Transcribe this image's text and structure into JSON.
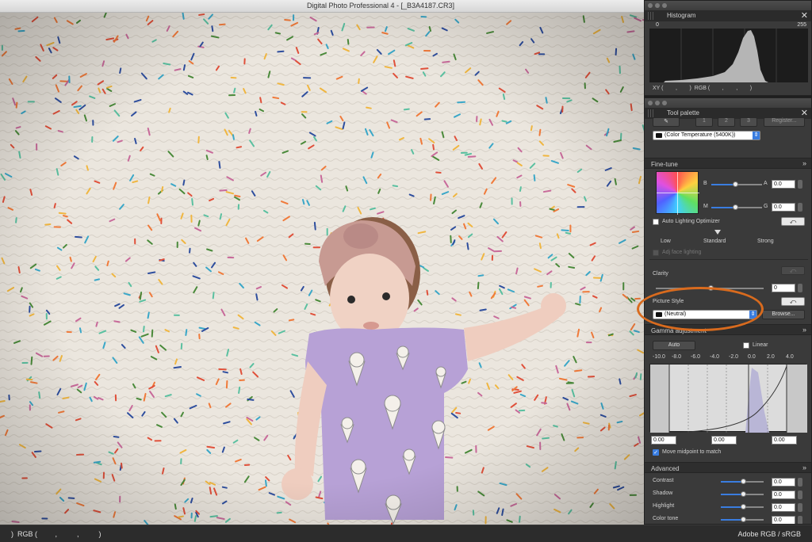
{
  "window": {
    "title": "Digital Photo Professional 4 - [_B3A4187.CR3]"
  },
  "histogram": {
    "title": "Histogram",
    "scale_min": "0",
    "scale_max": "255",
    "readout": "XY (        ,        )  RGB (        ,        ,        )"
  },
  "tool_palette": {
    "title": "Tool palette",
    "tabs": [
      "1",
      "2",
      "3"
    ],
    "register_label": "Register...",
    "wb_select": "(Color Temperature (5400K))",
    "finetune": {
      "title": "Fine-tune",
      "b_label": "B",
      "a_label": "A",
      "m_label": "M",
      "g_label": "G",
      "a_value": "0.0",
      "g_value": "0.0",
      "b_slider": 0.5,
      "m_slider": 0.5
    },
    "alo": {
      "label": "Auto Lighting Optimizer",
      "low": "Low",
      "standard": "Standard",
      "strong": "Strong",
      "face_label": "Adj face lighting"
    },
    "clarity": {
      "label": "Clarity",
      "value": "0"
    },
    "picture_style": {
      "label": "Picture Style",
      "value": "(Neutral)",
      "browse_label": "Browse..."
    },
    "gamma": {
      "title": "Gamma adjustment",
      "auto_label": "Auto",
      "linear_label": "Linear",
      "ticks": [
        "-10.0",
        "-8.0",
        "-6.0",
        "-4.0",
        "-2.0",
        "0.0",
        "2.0",
        "4.0"
      ],
      "black_value": "0.00",
      "mid_value": "0.00",
      "white_value": "0.00",
      "midpoint_label": "Move midpoint to match"
    },
    "advanced": {
      "title": "Advanced",
      "rows": [
        {
          "label": "Contrast",
          "value": "0.0"
        },
        {
          "label": "Shadow",
          "value": "0.0"
        },
        {
          "label": "Highlight",
          "value": "0.0"
        },
        {
          "label": "Color tone",
          "value": "0.0"
        }
      ]
    }
  },
  "statusbar": {
    "left": ")  RGB (         ,          ,          )",
    "right": "Adobe RGB / sRGB"
  },
  "colors": {
    "accent": "#3a7de0",
    "highlight_ellipse": "#d96b1e",
    "panel_bg": "#3a3a3a"
  }
}
